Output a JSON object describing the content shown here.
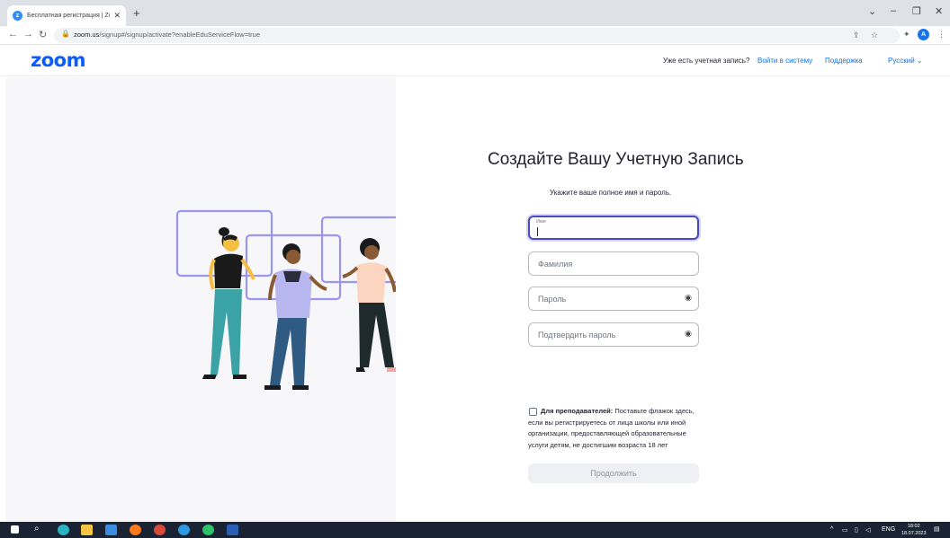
{
  "browser": {
    "tab_title": "Бесплатная регистрация | Zoom",
    "tab_close": "✕",
    "new_tab": "+",
    "url_host": "zoom.us",
    "url_path": "/signup#/signup/activate?enableEduServiceFlow=true",
    "profile_initial": "A"
  },
  "header": {
    "logo": "zoom",
    "have_account": "Уже есть учетная запись?",
    "login": "Войти в систему",
    "support": "Поддержка",
    "language": "Русский ⌄"
  },
  "form": {
    "title": "Создайте Вашу Учетную Запись",
    "subtitle": "Укажите ваше полное имя и пароль.",
    "first_name_label": "Имя",
    "last_name_placeholder": "Фамилия",
    "password_placeholder": "Пароль",
    "confirm_placeholder": "Подтвердить пароль",
    "edu_label_bold": "Для преподавателей:",
    "edu_label_text": "Поставьте флажок здесь, если вы регистрируетесь от лица школы или иной организации, предоставляющей образовательные услуги детям, не достигшим возраста 18 лет",
    "continue": "Продолжить"
  },
  "taskbar": {
    "lang": "ENG",
    "time": "18:02",
    "date": "18.07.2023"
  },
  "colors": {
    "brand": "#0b5cff",
    "link": "#0e72ed",
    "focus": "#4848c6",
    "illustration_frame": "#9c95f0"
  }
}
